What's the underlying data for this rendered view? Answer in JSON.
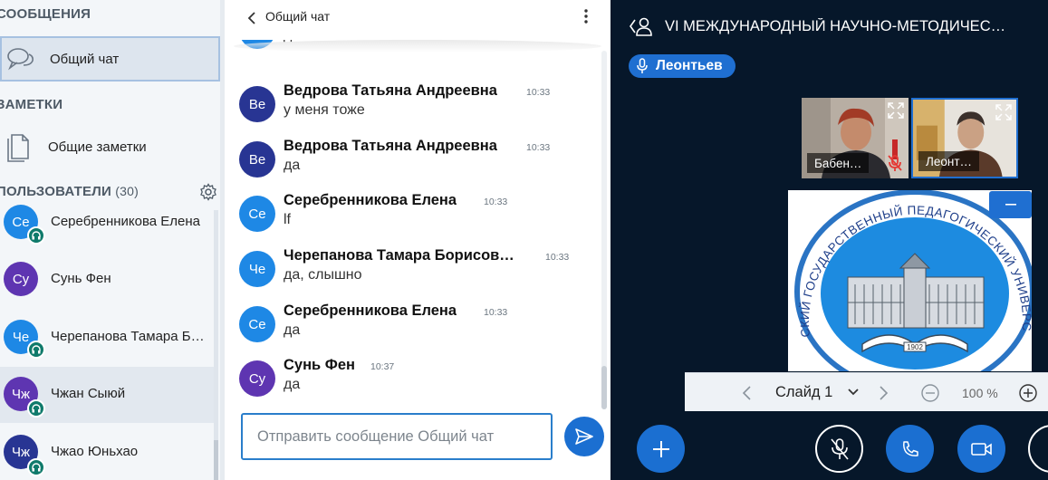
{
  "sidebar": {
    "messages_section": "СООБЩЕНИЯ",
    "public_chat_label": "Общий чат",
    "notes_section": "ЗАМЕТКИ",
    "shared_notes_label": "Общие заметки",
    "users_section_title": "ПОЛЬЗОВАТЕЛИ",
    "users_count": "(30)",
    "users": [
      {
        "initials": "Се",
        "name": "Серебренникова Елена",
        "color": "#1e88e5"
      },
      {
        "initials": "Су",
        "name": "Сунь Фен",
        "color": "#5e35b1"
      },
      {
        "initials": "Че",
        "name": "Черепанова Тамара Б…",
        "color": "#1e88e5"
      },
      {
        "initials": "Чж",
        "name": "Чжан Сыюй",
        "color": "#5e35b1"
      },
      {
        "initials": "Чж",
        "name": "Чжао Юньхао",
        "color": "#283593"
      }
    ]
  },
  "chat": {
    "title": "Общий чат",
    "messages": [
      {
        "initials": "",
        "sender": "",
        "time": "",
        "text": "да",
        "color": "#1e88e5"
      },
      {
        "initials": "Ве",
        "sender": "Ведрова Татьяна Андреевна",
        "time": "10:33",
        "text": "у меня тоже",
        "color": "#283593"
      },
      {
        "initials": "Ве",
        "sender": "Ведрова Татьяна Андреевна",
        "time": "10:33",
        "text": "да",
        "color": "#283593"
      },
      {
        "initials": "Се",
        "sender": "Серебренникова Елена",
        "time": "10:33",
        "text": "lf",
        "color": "#1e88e5"
      },
      {
        "initials": "Че",
        "sender": "Черепанова Тамара Борисов…",
        "time": "10:33",
        "text": "да, слышно",
        "color": "#1e88e5"
      },
      {
        "initials": "Се",
        "sender": "Серебренникова Елена",
        "time": "10:33",
        "text": "да",
        "color": "#1e88e5"
      },
      {
        "initials": "Су",
        "sender": "Сунь Фен",
        "time": "10:37",
        "text": "да",
        "color": "#5e35b1"
      }
    ],
    "input_placeholder": "Отправить сообщение Общий чат"
  },
  "stage": {
    "meeting_title": "VI МЕЖДУНАРОДНЫЙ НАУЧНО-МЕТОДИЧЕС…",
    "talking_indicator": "Леонтьев",
    "cameras": [
      {
        "name": "Бабен…",
        "muted": true
      },
      {
        "name": "Леонт…",
        "muted": false
      }
    ],
    "slide_logo_text": "ТОМСКИЙ ГОСУДАРСТВЕННЫЙ ПЕДАГОГИЧЕСКИЙ УНИВЕРСИТЕТ",
    "slide_logo_year": "1902",
    "slide_selector": "Слайд 1",
    "zoom": "100 %"
  },
  "colors": {
    "accent": "#1f6fd1",
    "stage_background": "#06172a",
    "listen_badge": "#0f7a6b",
    "muted": "#e53935"
  },
  "icons": [
    "chat-bubbles-icon",
    "notes-icon",
    "gear-icon",
    "headphones-icon",
    "chevron-left-icon",
    "more-vertical-icon",
    "send-icon",
    "user-icon",
    "microphone-icon",
    "expand-icon",
    "mic-muted-icon",
    "minimize-icon",
    "chevron-down-icon",
    "chevron-right-icon",
    "zoom-out-icon",
    "zoom-in-icon",
    "plus-icon",
    "phone-icon",
    "video-camera-icon"
  ]
}
